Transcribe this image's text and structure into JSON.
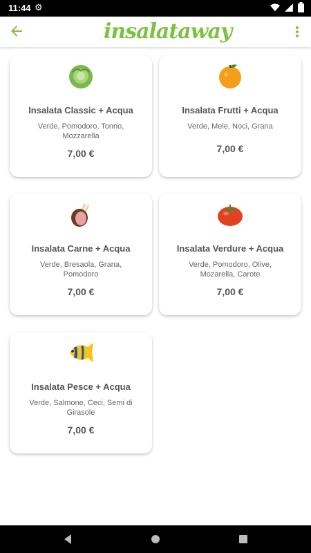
{
  "status": {
    "time": "11:44"
  },
  "app": {
    "logo_text": "insalataway"
  },
  "products": [
    {
      "name": "Insalata Classic + Acqua",
      "ingredients": "Verde, Pomodoro, Tonno, Mozzarella",
      "price": "7,00 €",
      "icon": "lettuce-icon"
    },
    {
      "name": "Insalata Frutti + Acqua",
      "ingredients": "Verde, Mele, Noci, Grana",
      "price": "7,00 €",
      "icon": "orange-icon"
    },
    {
      "name": "Insalata Carne + Acqua",
      "ingredients": "Verde, Bresaola, Grana, Pomodoro",
      "price": "7,00 €",
      "icon": "meat-icon"
    },
    {
      "name": "Insalata Verdure + Acqua",
      "ingredients": "Verde, Pomodoro, Olive, Mozarella, Carote",
      "price": "7,00 €",
      "icon": "tomato-icon"
    },
    {
      "name": "Insalata Pesce + Acqua",
      "ingredients": "Verde, Salmone, Ceci, Semi di Girasole",
      "price": "7,00 €",
      "icon": "fish-icon"
    }
  ],
  "colors": {
    "brand_green": "#7cc242",
    "text_dark": "#555555"
  }
}
